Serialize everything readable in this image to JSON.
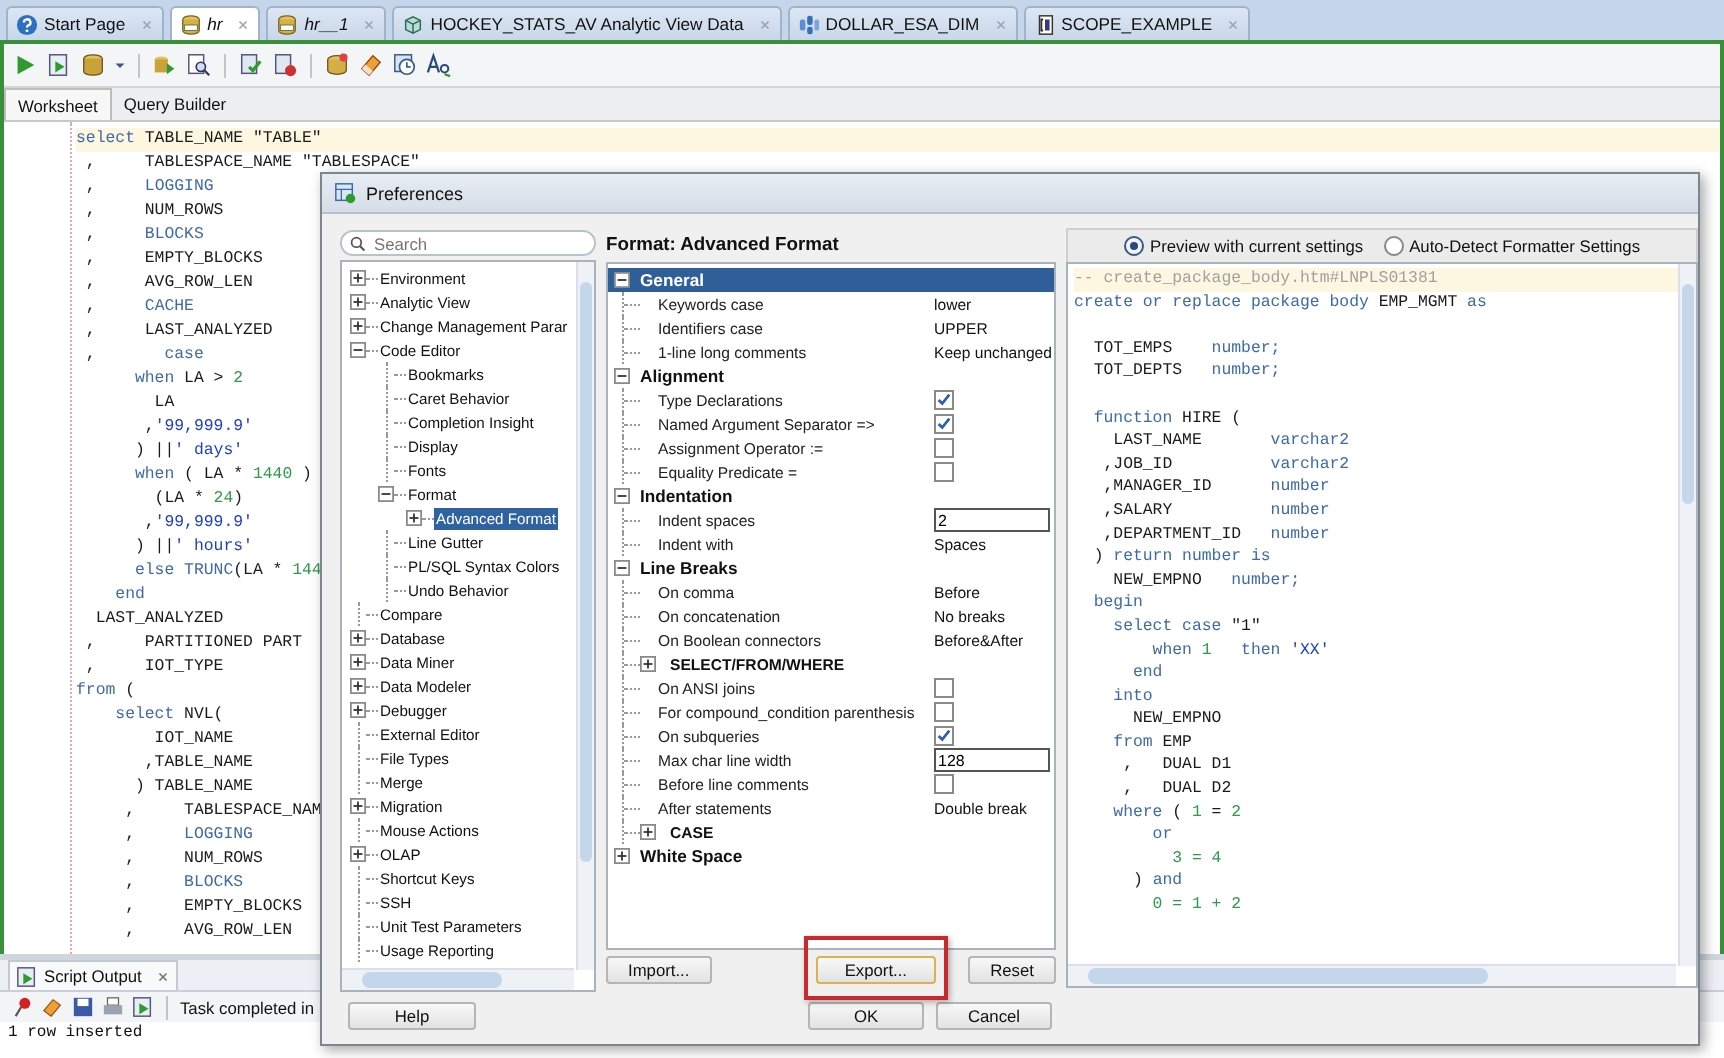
{
  "tabs": [
    {
      "label": "Start Page",
      "kind": "start",
      "unsaved": false,
      "selected": false
    },
    {
      "label": "hr",
      "kind": "worksheet",
      "unsaved": true,
      "selected": true
    },
    {
      "label": "hr__1",
      "kind": "worksheet",
      "unsaved": true,
      "selected": false
    },
    {
      "label": "HOCKEY_STATS_AV Analytic View Data",
      "kind": "view",
      "unsaved": false,
      "selected": false
    },
    {
      "label": "DOLLAR_ESA_DIM",
      "kind": "dimension",
      "unsaved": false,
      "selected": false
    },
    {
      "label": "SCOPE_EXAMPLE",
      "kind": "script",
      "unsaved": false,
      "selected": false
    }
  ],
  "editor_tabs": [
    {
      "label": "Worksheet",
      "selected": true
    },
    {
      "label": "Query Builder",
      "selected": false
    }
  ],
  "editor": {
    "lines": [
      {
        "current": true,
        "tokens": [
          {
            "kind": "kw",
            "text": "select"
          },
          {
            "kind": "id",
            "text": " TABLE_NAME \"TABLE\""
          }
        ]
      },
      {
        "current": false,
        "tokens": [
          {
            "kind": "id",
            "text": " ,     TABLESPACE_NAME \"TABLESPACE\""
          }
        ]
      },
      {
        "current": false,
        "tokens": [
          {
            "kind": "id",
            "text": " ,     "
          },
          {
            "kind": "kw",
            "text": "LOGGING"
          }
        ]
      },
      {
        "current": false,
        "tokens": [
          {
            "kind": "id",
            "text": " ,     NUM_ROWS"
          }
        ]
      },
      {
        "current": false,
        "tokens": [
          {
            "kind": "id",
            "text": " ,     "
          },
          {
            "kind": "kw",
            "text": "BLOCKS"
          }
        ]
      },
      {
        "current": false,
        "tokens": [
          {
            "kind": "id",
            "text": " ,     EMPTY_BLOCKS"
          }
        ]
      },
      {
        "current": false,
        "tokens": [
          {
            "kind": "id",
            "text": " ,     AVG_ROW_LEN"
          }
        ]
      },
      {
        "current": false,
        "tokens": [
          {
            "kind": "id",
            "text": " ,     "
          },
          {
            "kind": "kw",
            "text": "CACHE"
          }
        ]
      },
      {
        "current": false,
        "tokens": [
          {
            "kind": "id",
            "text": " ,     LAST_ANALYZED"
          }
        ]
      },
      {
        "current": false,
        "tokens": [
          {
            "kind": "id",
            "text": " ,       "
          },
          {
            "kind": "kw",
            "text": "case"
          }
        ]
      },
      {
        "current": false,
        "tokens": [
          {
            "kind": "kw",
            "text": "      when "
          },
          {
            "kind": "id",
            "text": "LA > "
          },
          {
            "kind": "num",
            "text": "2"
          }
        ]
      },
      {
        "current": false,
        "tokens": [
          {
            "kind": "id",
            "text": "        LA"
          }
        ]
      },
      {
        "current": false,
        "tokens": [
          {
            "kind": "id",
            "text": "       ,"
          },
          {
            "kind": "str",
            "text": "'99,999.9'"
          }
        ]
      },
      {
        "current": false,
        "tokens": [
          {
            "kind": "id",
            "text": "      ) ||"
          },
          {
            "kind": "str",
            "text": "' days'"
          }
        ]
      },
      {
        "current": false,
        "tokens": [
          {
            "kind": "kw",
            "text": "      when "
          },
          {
            "kind": "id",
            "text": "( LA * "
          },
          {
            "kind": "num",
            "text": "1440"
          },
          {
            "kind": "id",
            "text": " )"
          }
        ]
      },
      {
        "current": false,
        "tokens": [
          {
            "kind": "id",
            "text": "        (LA * "
          },
          {
            "kind": "num",
            "text": "24"
          },
          {
            "kind": "id",
            "text": ")"
          }
        ]
      },
      {
        "current": false,
        "tokens": [
          {
            "kind": "id",
            "text": "       ,"
          },
          {
            "kind": "str",
            "text": "'99,999.9'"
          }
        ]
      },
      {
        "current": false,
        "tokens": [
          {
            "kind": "id",
            "text": "      ) ||"
          },
          {
            "kind": "str",
            "text": "' hours'"
          }
        ]
      },
      {
        "current": false,
        "tokens": [
          {
            "kind": "kw",
            "text": "      else TRUNC"
          },
          {
            "kind": "id",
            "text": "(LA * "
          },
          {
            "kind": "num",
            "text": "144"
          }
        ]
      },
      {
        "current": false,
        "tokens": [
          {
            "kind": "kw",
            "text": "    end"
          }
        ]
      },
      {
        "current": false,
        "tokens": [
          {
            "kind": "id",
            "text": "  LAST_ANALYZED"
          }
        ]
      },
      {
        "current": false,
        "tokens": [
          {
            "kind": "id",
            "text": " ,     PARTITIONED PART"
          }
        ]
      },
      {
        "current": false,
        "tokens": [
          {
            "kind": "id",
            "text": " ,     IOT_TYPE"
          }
        ]
      },
      {
        "current": false,
        "tokens": [
          {
            "kind": "kw",
            "text": "from"
          },
          {
            "kind": "id",
            "text": " ("
          }
        ]
      },
      {
        "current": false,
        "tokens": [
          {
            "kind": "kw",
            "text": "    select "
          },
          {
            "kind": "id",
            "text": "NVL("
          }
        ]
      },
      {
        "current": false,
        "tokens": [
          {
            "kind": "id",
            "text": "        IOT_NAME"
          }
        ]
      },
      {
        "current": false,
        "tokens": [
          {
            "kind": "id",
            "text": "       ,TABLE_NAME"
          }
        ]
      },
      {
        "current": false,
        "tokens": [
          {
            "kind": "id",
            "text": "      ) TABLE_NAME"
          }
        ]
      },
      {
        "current": false,
        "tokens": [
          {
            "kind": "id",
            "text": "     ,     TABLESPACE_NAM"
          }
        ]
      },
      {
        "current": false,
        "tokens": [
          {
            "kind": "id",
            "text": "     ,     "
          },
          {
            "kind": "kw",
            "text": "LOGGING"
          }
        ]
      },
      {
        "current": false,
        "tokens": [
          {
            "kind": "id",
            "text": "     ,     NUM_ROWS"
          }
        ]
      },
      {
        "current": false,
        "tokens": [
          {
            "kind": "id",
            "text": "     ,     "
          },
          {
            "kind": "kw",
            "text": "BLOCKS"
          }
        ]
      },
      {
        "current": false,
        "tokens": [
          {
            "kind": "id",
            "text": "     ,     EMPTY_BLOCKS"
          }
        ]
      },
      {
        "current": false,
        "tokens": [
          {
            "kind": "id",
            "text": "     ,     AVG_ROW_LEN"
          }
        ]
      }
    ]
  },
  "output_panel": {
    "tab": "Script Output",
    "status": "Task completed in",
    "lines": [
      "1 row inserted"
    ]
  },
  "dialog": {
    "title": "Preferences",
    "search": {
      "placeholder": "Search"
    },
    "tree": [
      {
        "label": "Environment",
        "expanded": false,
        "selected": false
      },
      {
        "label": "Analytic View",
        "expanded": false,
        "selected": false
      },
      {
        "label": "Change Management Parar",
        "expanded": false,
        "selected": false
      },
      {
        "label": "Code Editor",
        "expanded": true,
        "selected": false,
        "children": [
          {
            "label": "Bookmarks",
            "selected": false
          },
          {
            "label": "Caret Behavior",
            "selected": false
          },
          {
            "label": "Completion Insight",
            "selected": false
          },
          {
            "label": "Display",
            "selected": false
          },
          {
            "label": "Fonts",
            "selected": false
          },
          {
            "label": "Format",
            "expanded": true,
            "selected": false,
            "children": [
              {
                "label": "Advanced Format",
                "expanded": false,
                "selected": true
              }
            ]
          },
          {
            "label": "Line Gutter",
            "selected": false
          },
          {
            "label": "PL/SQL Syntax Colors",
            "selected": false
          },
          {
            "label": "Undo Behavior",
            "selected": false
          }
        ]
      },
      {
        "label": "Compare",
        "selected": false
      },
      {
        "label": "Database",
        "expanded": false,
        "selected": false
      },
      {
        "label": "Data Miner",
        "expanded": false,
        "selected": false
      },
      {
        "label": "Data Modeler",
        "expanded": false,
        "selected": false
      },
      {
        "label": "Debugger",
        "expanded": false,
        "selected": false
      },
      {
        "label": "External Editor",
        "selected": false
      },
      {
        "label": "File Types",
        "selected": false
      },
      {
        "label": "Merge",
        "selected": false
      },
      {
        "label": "Migration",
        "expanded": false,
        "selected": false
      },
      {
        "label": "Mouse Actions",
        "selected": false
      },
      {
        "label": "OLAP",
        "expanded": false,
        "selected": false
      },
      {
        "label": "Shortcut Keys",
        "selected": false
      },
      {
        "label": "SSH",
        "selected": false
      },
      {
        "label": "Unit Test Parameters",
        "selected": false
      },
      {
        "label": "Usage Reporting",
        "selected": false
      }
    ],
    "page_title": "Format: Advanced Format",
    "sections": [
      {
        "label": "General",
        "expanded": true,
        "selected": true,
        "rows": [
          {
            "kind": "text",
            "label": "Keywords case",
            "value": "lower"
          },
          {
            "kind": "text",
            "label": "Identifiers case",
            "value": "UPPER"
          },
          {
            "kind": "text",
            "label": "1-line long comments",
            "value": "Keep unchanged"
          }
        ]
      },
      {
        "label": "Alignment",
        "expanded": true,
        "selected": false,
        "rows": [
          {
            "kind": "check",
            "label": "Type Declarations",
            "checked": true
          },
          {
            "kind": "check",
            "label": "Named Argument Separator =>",
            "checked": true
          },
          {
            "kind": "check",
            "label": "Assignment Operator :=",
            "checked": false
          },
          {
            "kind": "check",
            "label": "Equality Predicate =",
            "checked": false
          }
        ]
      },
      {
        "label": "Indentation",
        "expanded": true,
        "selected": false,
        "rows": [
          {
            "kind": "input",
            "label": "Indent spaces",
            "value": "2"
          },
          {
            "kind": "text",
            "label": "Indent with",
            "value": "Spaces"
          }
        ]
      },
      {
        "label": "Line Breaks",
        "expanded": true,
        "selected": false,
        "rows": [
          {
            "kind": "text",
            "label": "On comma",
            "value": "Before"
          },
          {
            "kind": "text",
            "label": "On concatenation",
            "value": "No breaks"
          },
          {
            "kind": "text",
            "label": "On Boolean connectors",
            "value": "Before&After"
          },
          {
            "kind": "group",
            "label": "SELECT/FROM/WHERE",
            "expanded": false
          },
          {
            "kind": "check",
            "label": "On ANSI joins",
            "checked": false
          },
          {
            "kind": "check",
            "label": "For compound_condition parenthesis",
            "checked": false
          },
          {
            "kind": "check",
            "label": "On subqueries",
            "checked": true
          },
          {
            "kind": "input",
            "label": "Max char line width",
            "value": "128"
          },
          {
            "kind": "check",
            "label": "Before line comments",
            "checked": false
          },
          {
            "kind": "text",
            "label": "After statements",
            "value": "Double break"
          },
          {
            "kind": "group",
            "label": "CASE",
            "expanded": false
          }
        ]
      },
      {
        "label": "White Space",
        "expanded": false,
        "selected": false
      }
    ],
    "panel_buttons": [
      {
        "label": "Import...",
        "highlighted": false
      },
      {
        "label": "Export...",
        "highlighted": true
      },
      {
        "label": "Reset",
        "highlighted": false
      }
    ],
    "preview_options": [
      {
        "label": "Preview with current settings",
        "selected": true
      },
      {
        "label": "Auto-Detect Formatter Settings",
        "selected": false
      }
    ],
    "preview": [
      {
        "current": true,
        "tokens": [
          {
            "kind": "com",
            "text": "-- create_package_body.htm#LNPLS01381"
          }
        ]
      },
      {
        "current": false,
        "tokens": [
          {
            "kind": "kw",
            "text": "create or replace package body "
          },
          {
            "kind": "id",
            "text": "EMP_MGMT"
          },
          {
            "kind": "kw",
            "text": " as"
          }
        ]
      },
      {
        "current": false
      },
      {
        "current": false,
        "tokens": [
          {
            "kind": "id",
            "text": "  TOT_EMPS    "
          },
          {
            "kind": "kw",
            "text": "number;"
          }
        ]
      },
      {
        "current": false,
        "tokens": [
          {
            "kind": "id",
            "text": "  TOT_DEPTS   "
          },
          {
            "kind": "kw",
            "text": "number;"
          }
        ]
      },
      {
        "current": false
      },
      {
        "current": false,
        "tokens": [
          {
            "kind": "kw",
            "text": "  function "
          },
          {
            "kind": "id",
            "text": "HIRE ("
          }
        ]
      },
      {
        "current": false,
        "tokens": [
          {
            "kind": "id",
            "text": "    LAST_NAME       "
          },
          {
            "kind": "kw",
            "text": "varchar2"
          }
        ]
      },
      {
        "current": false,
        "tokens": [
          {
            "kind": "id",
            "text": "   ,JOB_ID          "
          },
          {
            "kind": "kw",
            "text": "varchar2"
          }
        ]
      },
      {
        "current": false,
        "tokens": [
          {
            "kind": "id",
            "text": "   ,MANAGER_ID      "
          },
          {
            "kind": "kw",
            "text": "number"
          }
        ]
      },
      {
        "current": false,
        "tokens": [
          {
            "kind": "id",
            "text": "   ,SALARY          "
          },
          {
            "kind": "kw",
            "text": "number"
          }
        ]
      },
      {
        "current": false,
        "tokens": [
          {
            "kind": "id",
            "text": "   ,DEPARTMENT_ID   "
          },
          {
            "kind": "kw",
            "text": "number"
          }
        ]
      },
      {
        "current": false,
        "tokens": [
          {
            "kind": "id",
            "text": "  ) "
          },
          {
            "kind": "kw",
            "text": "return number is"
          }
        ]
      },
      {
        "current": false,
        "tokens": [
          {
            "kind": "id",
            "text": "    NEW_EMPNO   "
          },
          {
            "kind": "kw",
            "text": "number;"
          }
        ]
      },
      {
        "current": false,
        "tokens": [
          {
            "kind": "kw",
            "text": "  begin"
          }
        ]
      },
      {
        "current": false,
        "tokens": [
          {
            "kind": "kw",
            "text": "    select case "
          },
          {
            "kind": "id",
            "text": "\"1\""
          }
        ]
      },
      {
        "current": false,
        "tokens": [
          {
            "kind": "kw",
            "text": "        when "
          },
          {
            "kind": "num",
            "text": "1"
          },
          {
            "kind": "kw",
            "text": "   then "
          },
          {
            "kind": "str",
            "text": "'XX'"
          }
        ]
      },
      {
        "current": false,
        "tokens": [
          {
            "kind": "kw",
            "text": "      end"
          }
        ]
      },
      {
        "current": false,
        "tokens": [
          {
            "kind": "kw",
            "text": "    into"
          }
        ]
      },
      {
        "current": false,
        "tokens": [
          {
            "kind": "id",
            "text": "      NEW_EMPNO"
          }
        ]
      },
      {
        "current": false,
        "tokens": [
          {
            "kind": "kw",
            "text": "    from "
          },
          {
            "kind": "id",
            "text": "EMP"
          }
        ]
      },
      {
        "current": false,
        "tokens": [
          {
            "kind": "id",
            "text": "     ,   DUAL D1"
          }
        ]
      },
      {
        "current": false,
        "tokens": [
          {
            "kind": "id",
            "text": "     ,   DUAL D2"
          }
        ]
      },
      {
        "current": false,
        "tokens": [
          {
            "kind": "kw",
            "text": "    where "
          },
          {
            "kind": "id",
            "text": "( "
          },
          {
            "kind": "num",
            "text": "1"
          },
          {
            "kind": "id",
            "text": " = "
          },
          {
            "kind": "num",
            "text": "2"
          }
        ]
      },
      {
        "current": false,
        "tokens": [
          {
            "kind": "kw",
            "text": "        or"
          }
        ]
      },
      {
        "current": false,
        "tokens": [
          {
            "kind": "num",
            "text": "          3 = 4"
          }
        ]
      },
      {
        "current": false,
        "tokens": [
          {
            "kind": "id",
            "text": "      ) "
          },
          {
            "kind": "kw",
            "text": "and"
          }
        ]
      },
      {
        "current": false,
        "tokens": [
          {
            "kind": "num",
            "text": "        0 = 1 + 2"
          }
        ]
      }
    ],
    "buttons": [
      {
        "label": "Help"
      },
      {
        "label": "OK"
      },
      {
        "label": "Cancel"
      }
    ]
  }
}
